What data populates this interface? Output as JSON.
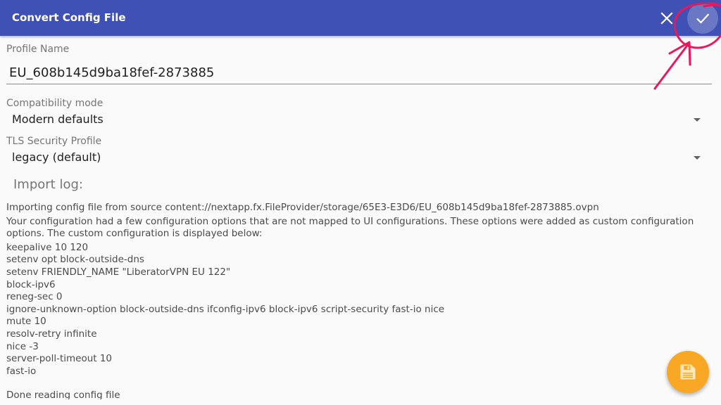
{
  "appbar": {
    "title": "Convert Config File",
    "close_icon": "close-icon",
    "confirm_icon": "check-icon",
    "color": "#3f51b5"
  },
  "profile": {
    "label": "Profile Name",
    "value": "EU_608b145d9ba18fef-2873885"
  },
  "compat": {
    "label": "Compatibility mode",
    "value": "Modern defaults"
  },
  "tls": {
    "label": "TLS Security Profile",
    "value": "legacy (default)"
  },
  "log": {
    "heading": "Import log:",
    "intro1": "Importing config file from source content://nextapp.fx.FileProvider/storage/65E3-E3D6/EU_608b145d9ba18fef-2873885.ovpn",
    "intro2": "Your configuration had a few configuration options that are not mapped to UI configurations. These options were added as custom configuration options. The custom configuration is displayed below:",
    "lines": [
      "keepalive 10 120",
      "setenv opt block-outside-dns",
      "setenv FRIENDLY_NAME \"LiberatorVPN EU 122\"",
      "block-ipv6",
      "reneg-sec 0",
      "ignore-unknown-option block-outside-dns ifconfig-ipv6 block-ipv6 script-security fast-io nice",
      "mute 10",
      "resolv-retry infinite",
      "nice -3",
      "server-poll-timeout 10",
      "fast-io"
    ],
    "done": "Done reading config file"
  },
  "fab": {
    "icon": "save-icon",
    "color": "#f9a825"
  },
  "annotation": {
    "color": "#e8185a"
  }
}
